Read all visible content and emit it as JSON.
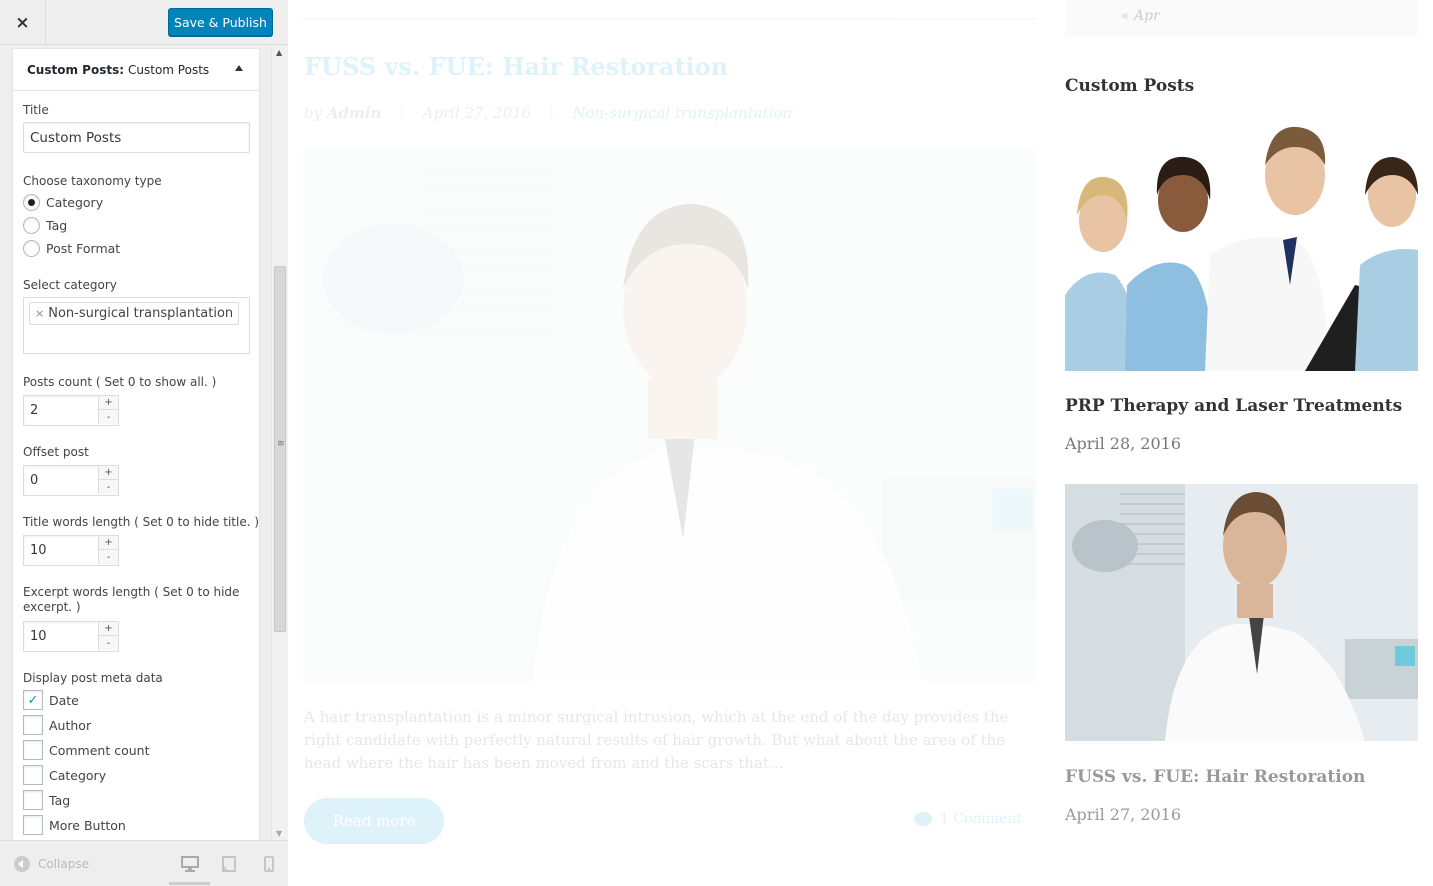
{
  "topbar": {
    "close_label": "×",
    "publish_label": "Save & Publish"
  },
  "widget": {
    "header_type": "Custom Posts:",
    "header_name": "Custom Posts",
    "title_label": "Title",
    "title_value": "Custom Posts",
    "taxonomy_label": "Choose taxonomy type",
    "taxonomy_options": [
      {
        "label": "Category",
        "selected": true
      },
      {
        "label": "Tag",
        "selected": false
      },
      {
        "label": "Post Format",
        "selected": false
      }
    ],
    "select_category_label": "Select category",
    "selected_category": "Non-surgical transplantation",
    "chip_remove": "×",
    "posts_count_label": "Posts count ( Set 0 to show all. )",
    "posts_count_value": "2",
    "offset_label": "Offset post",
    "offset_value": "0",
    "title_words_label": "Title words length ( Set 0 to hide title. )",
    "title_words_value": "10",
    "excerpt_words_label": "Excerpt words length ( Set 0 to hide excerpt. )",
    "excerpt_words_value": "10",
    "meta_label": "Display post meta data",
    "meta_options": [
      {
        "label": "Date",
        "checked": true
      },
      {
        "label": "Author",
        "checked": false
      },
      {
        "label": "Comment count",
        "checked": false
      },
      {
        "label": "Category",
        "checked": false
      },
      {
        "label": "Tag",
        "checked": false
      },
      {
        "label": "More Button",
        "checked": false
      }
    ],
    "stepper_plus": "+",
    "stepper_minus": "-"
  },
  "footer": {
    "collapse_label": "Collapse"
  },
  "preview": {
    "post_title": "FUSS vs. FUE: Hair Restoration",
    "meta_by": "by",
    "meta_author": "Admin",
    "meta_date": "April 27, 2016",
    "meta_category": "Non-surgical transplantation",
    "excerpt": "A hair transplantation is a minor surgical intrusion, which at the end of the day provides the right candidate with perfectly natural results of hair growth. But what about  the area of the head where the hair has been moved from and the scars that…",
    "read_more": "Read more",
    "comments": "1 Comment",
    "prev_month": "« Apr",
    "widget_title": "Custom Posts",
    "posts": [
      {
        "title": "PRP Therapy and Laser Treatments",
        "date": "April 28, 2016"
      },
      {
        "title": "FUSS vs. FUE: Hair Restoration",
        "date": "April 27, 2016"
      }
    ]
  },
  "colors": {
    "publish_blue": "#0085ba",
    "link_blue": "#1aa6d9",
    "sidebar_bg": "#eeeeee"
  }
}
